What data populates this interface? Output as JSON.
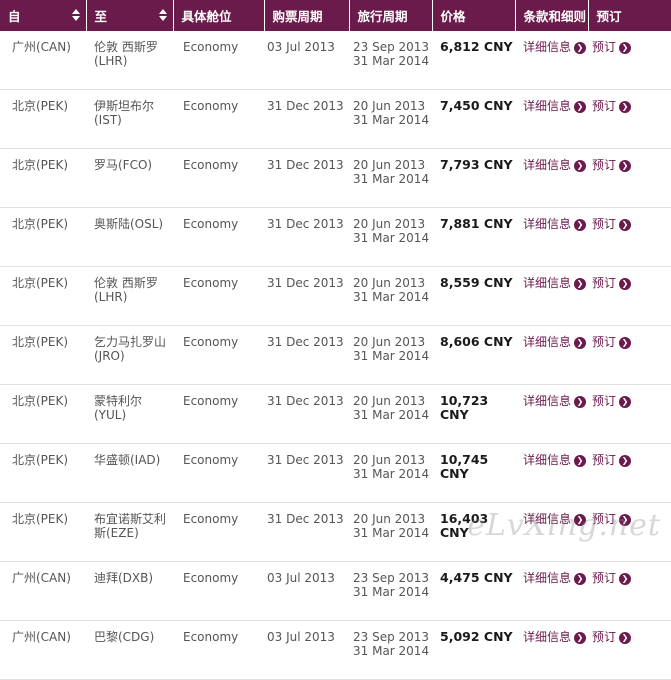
{
  "header": {
    "from": "自",
    "to": "至",
    "cabin": "具体舱位",
    "purchase": "购票周期",
    "travel": "旅行周期",
    "price": "价格",
    "terms": "条款和细则",
    "book": "预订"
  },
  "action_labels": {
    "details": "详细信息",
    "book": "预订"
  },
  "rows": [
    {
      "from": "广州(CAN)",
      "to": "伦敦 西斯罗(LHR)",
      "cabin": "Economy",
      "purchase": "03 Jul 2013",
      "travel_start": "23 Sep 2013",
      "travel_end": "31 Mar 2014",
      "price": "6,812 CNY"
    },
    {
      "from": "北京(PEK)",
      "to": "伊斯坦布尔(IST)",
      "cabin": "Economy",
      "purchase": "31 Dec 2013",
      "travel_start": "20 Jun 2013",
      "travel_end": "31 Mar 2014",
      "price": "7,450 CNY"
    },
    {
      "from": "北京(PEK)",
      "to": "罗马(FCO)",
      "cabin": "Economy",
      "purchase": "31 Dec 2013",
      "travel_start": "20 Jun 2013",
      "travel_end": "31 Mar 2014",
      "price": "7,793 CNY"
    },
    {
      "from": "北京(PEK)",
      "to": "奥斯陆(OSL)",
      "cabin": "Economy",
      "purchase": "31 Dec 2013",
      "travel_start": "20 Jun 2013",
      "travel_end": "31 Mar 2014",
      "price": "7,881 CNY"
    },
    {
      "from": "北京(PEK)",
      "to": "伦敦 西斯罗(LHR)",
      "cabin": "Economy",
      "purchase": "31 Dec 2013",
      "travel_start": "20 Jun 2013",
      "travel_end": "31 Mar 2014",
      "price": "8,559 CNY"
    },
    {
      "from": "北京(PEK)",
      "to": "乞力马扎罗山(JRO)",
      "cabin": "Economy",
      "purchase": "31 Dec 2013",
      "travel_start": "20 Jun 2013",
      "travel_end": "31 Mar 2014",
      "price": "8,606 CNY"
    },
    {
      "from": "北京(PEK)",
      "to": "蒙特利尔(YUL)",
      "cabin": "Economy",
      "purchase": "31 Dec 2013",
      "travel_start": "20 Jun 2013",
      "travel_end": "31 Mar 2014",
      "price": "10,723 CNY"
    },
    {
      "from": "北京(PEK)",
      "to": "华盛顿(IAD)",
      "cabin": "Economy",
      "purchase": "31 Dec 2013",
      "travel_start": "20 Jun 2013",
      "travel_end": "31 Mar 2014",
      "price": "10,745 CNY"
    },
    {
      "from": "北京(PEK)",
      "to": "布宜诺斯艾利斯(EZE)",
      "cabin": "Economy",
      "purchase": "31 Dec 2013",
      "travel_start": "20 Jun 2013",
      "travel_end": "31 Mar 2014",
      "price": "16,403 CNY"
    },
    {
      "from": "广州(CAN)",
      "to": "迪拜(DXB)",
      "cabin": "Economy",
      "purchase": "03 Jul 2013",
      "travel_start": "23 Sep 2013",
      "travel_end": "31 Mar 2014",
      "price": "4,475 CNY"
    },
    {
      "from": "广州(CAN)",
      "to": "巴黎(CDG)",
      "cabin": "Economy",
      "purchase": "03 Jul 2013",
      "travel_start": "23 Sep 2013",
      "travel_end": "31 Mar 2014",
      "price": "5,092 CNY"
    }
  ],
  "watermark": "eLvXing.net",
  "colors": {
    "header_bg": "#6b1a4c",
    "accent": "#6b1a4c"
  }
}
